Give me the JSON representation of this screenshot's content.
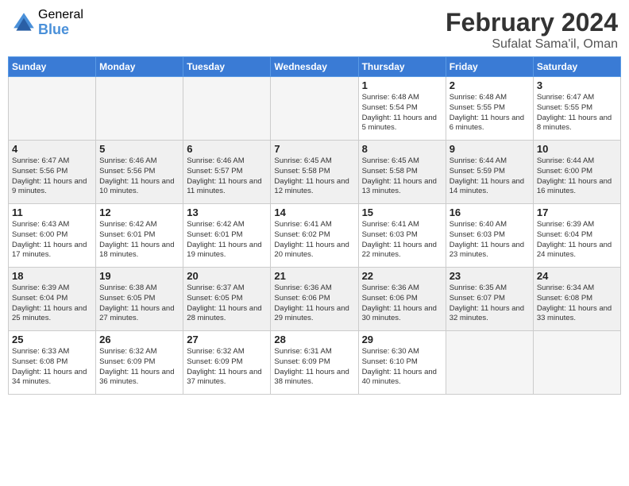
{
  "header": {
    "logo_general": "General",
    "logo_blue": "Blue",
    "month_year": "February 2024",
    "location": "Sufalat Sama'il, Oman"
  },
  "weekdays": [
    "Sunday",
    "Monday",
    "Tuesday",
    "Wednesday",
    "Thursday",
    "Friday",
    "Saturday"
  ],
  "weeks": [
    [
      {
        "day": "",
        "info": "",
        "empty": true
      },
      {
        "day": "",
        "info": "",
        "empty": true
      },
      {
        "day": "",
        "info": "",
        "empty": true
      },
      {
        "day": "",
        "info": "",
        "empty": true
      },
      {
        "day": "1",
        "info": "Sunrise: 6:48 AM\nSunset: 5:54 PM\nDaylight: 11 hours\nand 5 minutes.",
        "empty": false
      },
      {
        "day": "2",
        "info": "Sunrise: 6:48 AM\nSunset: 5:55 PM\nDaylight: 11 hours\nand 6 minutes.",
        "empty": false
      },
      {
        "day": "3",
        "info": "Sunrise: 6:47 AM\nSunset: 5:55 PM\nDaylight: 11 hours\nand 8 minutes.",
        "empty": false
      }
    ],
    [
      {
        "day": "4",
        "info": "Sunrise: 6:47 AM\nSunset: 5:56 PM\nDaylight: 11 hours\nand 9 minutes.",
        "empty": false
      },
      {
        "day": "5",
        "info": "Sunrise: 6:46 AM\nSunset: 5:56 PM\nDaylight: 11 hours\nand 10 minutes.",
        "empty": false
      },
      {
        "day": "6",
        "info": "Sunrise: 6:46 AM\nSunset: 5:57 PM\nDaylight: 11 hours\nand 11 minutes.",
        "empty": false
      },
      {
        "day": "7",
        "info": "Sunrise: 6:45 AM\nSunset: 5:58 PM\nDaylight: 11 hours\nand 12 minutes.",
        "empty": false
      },
      {
        "day": "8",
        "info": "Sunrise: 6:45 AM\nSunset: 5:58 PM\nDaylight: 11 hours\nand 13 minutes.",
        "empty": false
      },
      {
        "day": "9",
        "info": "Sunrise: 6:44 AM\nSunset: 5:59 PM\nDaylight: 11 hours\nand 14 minutes.",
        "empty": false
      },
      {
        "day": "10",
        "info": "Sunrise: 6:44 AM\nSunset: 6:00 PM\nDaylight: 11 hours\nand 16 minutes.",
        "empty": false
      }
    ],
    [
      {
        "day": "11",
        "info": "Sunrise: 6:43 AM\nSunset: 6:00 PM\nDaylight: 11 hours\nand 17 minutes.",
        "empty": false
      },
      {
        "day": "12",
        "info": "Sunrise: 6:42 AM\nSunset: 6:01 PM\nDaylight: 11 hours\nand 18 minutes.",
        "empty": false
      },
      {
        "day": "13",
        "info": "Sunrise: 6:42 AM\nSunset: 6:01 PM\nDaylight: 11 hours\nand 19 minutes.",
        "empty": false
      },
      {
        "day": "14",
        "info": "Sunrise: 6:41 AM\nSunset: 6:02 PM\nDaylight: 11 hours\nand 20 minutes.",
        "empty": false
      },
      {
        "day": "15",
        "info": "Sunrise: 6:41 AM\nSunset: 6:03 PM\nDaylight: 11 hours\nand 22 minutes.",
        "empty": false
      },
      {
        "day": "16",
        "info": "Sunrise: 6:40 AM\nSunset: 6:03 PM\nDaylight: 11 hours\nand 23 minutes.",
        "empty": false
      },
      {
        "day": "17",
        "info": "Sunrise: 6:39 AM\nSunset: 6:04 PM\nDaylight: 11 hours\nand 24 minutes.",
        "empty": false
      }
    ],
    [
      {
        "day": "18",
        "info": "Sunrise: 6:39 AM\nSunset: 6:04 PM\nDaylight: 11 hours\nand 25 minutes.",
        "empty": false
      },
      {
        "day": "19",
        "info": "Sunrise: 6:38 AM\nSunset: 6:05 PM\nDaylight: 11 hours\nand 27 minutes.",
        "empty": false
      },
      {
        "day": "20",
        "info": "Sunrise: 6:37 AM\nSunset: 6:05 PM\nDaylight: 11 hours\nand 28 minutes.",
        "empty": false
      },
      {
        "day": "21",
        "info": "Sunrise: 6:36 AM\nSunset: 6:06 PM\nDaylight: 11 hours\nand 29 minutes.",
        "empty": false
      },
      {
        "day": "22",
        "info": "Sunrise: 6:36 AM\nSunset: 6:06 PM\nDaylight: 11 hours\nand 30 minutes.",
        "empty": false
      },
      {
        "day": "23",
        "info": "Sunrise: 6:35 AM\nSunset: 6:07 PM\nDaylight: 11 hours\nand 32 minutes.",
        "empty": false
      },
      {
        "day": "24",
        "info": "Sunrise: 6:34 AM\nSunset: 6:08 PM\nDaylight: 11 hours\nand 33 minutes.",
        "empty": false
      }
    ],
    [
      {
        "day": "25",
        "info": "Sunrise: 6:33 AM\nSunset: 6:08 PM\nDaylight: 11 hours\nand 34 minutes.",
        "empty": false
      },
      {
        "day": "26",
        "info": "Sunrise: 6:32 AM\nSunset: 6:09 PM\nDaylight: 11 hours\nand 36 minutes.",
        "empty": false
      },
      {
        "day": "27",
        "info": "Sunrise: 6:32 AM\nSunset: 6:09 PM\nDaylight: 11 hours\nand 37 minutes.",
        "empty": false
      },
      {
        "day": "28",
        "info": "Sunrise: 6:31 AM\nSunset: 6:09 PM\nDaylight: 11 hours\nand 38 minutes.",
        "empty": false
      },
      {
        "day": "29",
        "info": "Sunrise: 6:30 AM\nSunset: 6:10 PM\nDaylight: 11 hours\nand 40 minutes.",
        "empty": false
      },
      {
        "day": "",
        "info": "",
        "empty": true
      },
      {
        "day": "",
        "info": "",
        "empty": true
      }
    ]
  ]
}
